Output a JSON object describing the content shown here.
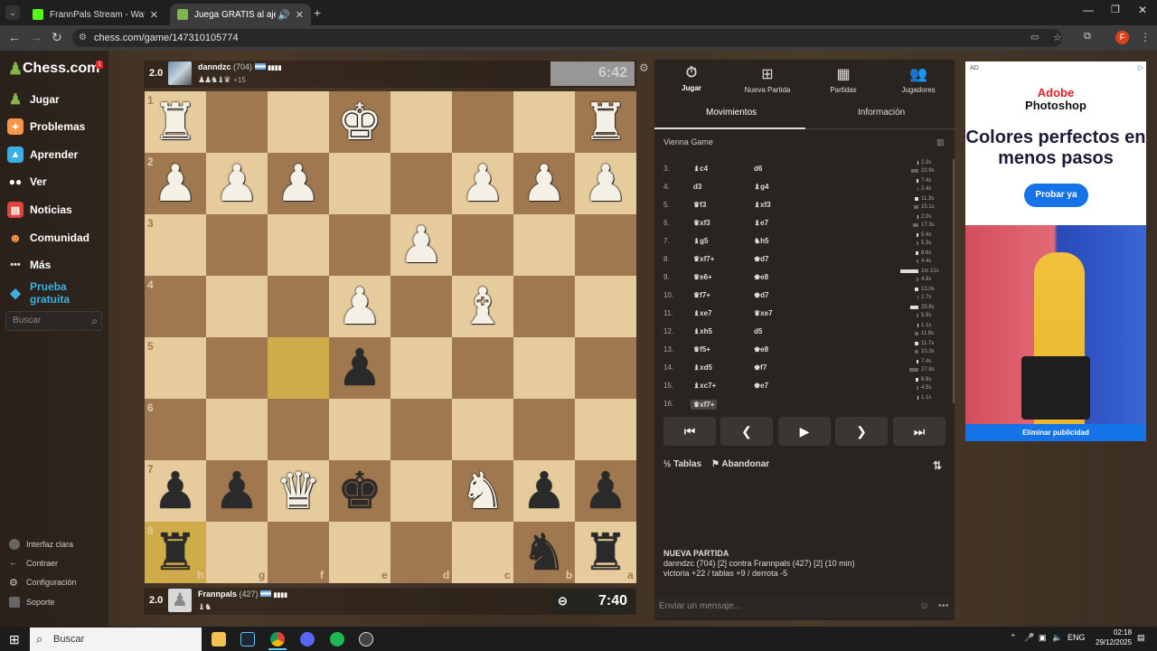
{
  "browser": {
    "tabs": [
      {
        "title": "FrannPals Stream - Watch Live o",
        "icon_color": "#53fc18",
        "active": false
      },
      {
        "title": "Juega GRATIS al ajedrez onl",
        "icon_color": "#81b64c",
        "active": true
      }
    ],
    "url": "chess.com/game/147310105774",
    "profile_initial": "F",
    "profile_color": "#d9421d"
  },
  "sidebar": {
    "logo": "Chess.com",
    "notification_count": "1",
    "items": [
      {
        "label": "Jugar",
        "icon": "pawn-icon",
        "color": "#81b64c"
      },
      {
        "label": "Problemas",
        "icon": "puzzle-icon",
        "color": "#f7954a"
      },
      {
        "label": "Aprender",
        "icon": "learn-icon",
        "color": "#3bb0e5"
      },
      {
        "label": "Ver",
        "icon": "binoculars-icon",
        "color": "#ffffff"
      },
      {
        "label": "Noticias",
        "icon": "news-icon",
        "color": "#e0443a"
      },
      {
        "label": "Comunidad",
        "icon": "community-icon",
        "color": "#f7954a"
      },
      {
        "label": "Más",
        "icon": "more-icon",
        "color": "#ffffff"
      },
      {
        "label": "Prueba gratuita",
        "icon": "diamond-icon",
        "color": "#3bb0e5"
      }
    ],
    "search_placeholder": "Buscar",
    "bottom": [
      "Interfaz clara",
      "Contraer",
      "Configuración",
      "Soporte"
    ]
  },
  "top_player": {
    "elo_diff": "2.0",
    "name": "danndzc",
    "rating": "(704)",
    "captured": "♟♟♞♝♛",
    "advantage": "+15",
    "clock": "6:42"
  },
  "bottom_player": {
    "elo_diff": "2.0",
    "name": "Frannpals",
    "rating": "(427)",
    "captured": "♝♞",
    "clock": "7:40"
  },
  "board": {
    "orientation": "black",
    "rank_labels": [
      "1",
      "2",
      "3",
      "4",
      "5",
      "6",
      "7",
      "8"
    ],
    "file_labels": [
      "h",
      "g",
      "f",
      "e",
      "d",
      "c",
      "b",
      "a"
    ],
    "rows": [
      [
        "wR",
        "",
        "",
        "wK",
        "",
        "",
        "",
        "wR"
      ],
      [
        "wP",
        "wP",
        "wP",
        "",
        "",
        "wP",
        "wP",
        "wP"
      ],
      [
        "",
        "",
        "",
        "",
        "wP",
        "",
        "",
        ""
      ],
      [
        "",
        "",
        "",
        "wP",
        "",
        "wB",
        "",
        ""
      ],
      [
        "",
        "",
        "",
        "bP",
        "",
        "",
        "",
        ""
      ],
      [
        "",
        "",
        "",
        "",
        "",
        "",
        "",
        ""
      ],
      [
        "bP",
        "bP",
        "wQ",
        "bK",
        "",
        "wN",
        "bP",
        "bP"
      ],
      [
        "bR",
        "",
        "",
        "",
        "",
        "",
        "bN",
        "bR"
      ]
    ],
    "highlights": [
      "f5",
      "h8"
    ]
  },
  "panel": {
    "tabs": [
      "Jugar",
      "Nueva Partida",
      "Partidas",
      "Jugadores"
    ],
    "subtabs": [
      "Movimientos",
      "Información"
    ],
    "opening": "Vienna Game",
    "moves": [
      {
        "num": "3.",
        "white": "♝c4",
        "black": "d6",
        "wt": "2.3s",
        "bt": "22.9s",
        "wf": 0.05,
        "bf": 0.4
      },
      {
        "num": "4.",
        "white": "d3",
        "black": "♝g4",
        "wt": "7.4s",
        "bt": "2.4s",
        "wf": 0.12,
        "bf": 0.05
      },
      {
        "num": "5.",
        "white": "♛f3",
        "black": "♝xf3",
        "wt": "11.3s",
        "bt": "15.1s",
        "wf": 0.2,
        "bf": 0.27
      },
      {
        "num": "6.",
        "white": "♛xf3",
        "black": "♝e7",
        "wt": "2.0s",
        "bt": "17.3s",
        "wf": 0.05,
        "bf": 0.3
      },
      {
        "num": "7.",
        "white": "♝g5",
        "black": "♞h5",
        "wt": "5.4s",
        "bt": "5.3s",
        "wf": 0.1,
        "bf": 0.1
      },
      {
        "num": "8.",
        "white": "♛xf7+",
        "black": "♚d7",
        "wt": "8.6s",
        "bt": "4.4s",
        "wf": 0.15,
        "bf": 0.08
      },
      {
        "num": "9.",
        "white": "♛e6+",
        "black": "♚e8",
        "wt": "1m 21s",
        "bt": "4.9s",
        "wf": 1.0,
        "bf": 0.09
      },
      {
        "num": "10.",
        "white": "♛f7+",
        "black": "♚d7",
        "wt": "13.0s",
        "bt": "2.7s",
        "wf": 0.22,
        "bf": 0.05
      },
      {
        "num": "11.",
        "white": "♝xe7",
        "black": "♛xe7",
        "wt": "25.8s",
        "bt": "5.9s",
        "wf": 0.45,
        "bf": 0.1
      },
      {
        "num": "12.",
        "white": "♝xh5",
        "black": "d5",
        "wt": "1.1s",
        "bt": "11.8s",
        "wf": 0.03,
        "bf": 0.2
      },
      {
        "num": "13.",
        "white": "♛f5+",
        "black": "♚e8",
        "wt": "11.7s",
        "bt": "10.3s",
        "wf": 0.2,
        "bf": 0.18
      },
      {
        "num": "14.",
        "white": "♝xd5",
        "black": "♚f7",
        "wt": "7.4s",
        "bt": "27.8s",
        "wf": 0.12,
        "bf": 0.48
      },
      {
        "num": "15.",
        "white": "♝xc7+",
        "black": "♚e7",
        "wt": "8.8s",
        "bt": "4.5s",
        "wf": 0.15,
        "bf": 0.08
      },
      {
        "num": "16.",
        "white": "♛xf7+",
        "black": "",
        "wt": "1.1s",
        "bt": "",
        "wf": 0.03,
        "bf": 0
      }
    ],
    "actions": [
      "Tablas",
      "Abandonar"
    ],
    "new_game": {
      "title": "NUEVA PARTIDA",
      "line1": "danndzc (704) [2] contra Frannpals (427) [2] (10 min)",
      "line2": "victoria +22 / tablas +9 / derrota -5"
    },
    "message_placeholder": "Enviar un mensaje..."
  },
  "ad": {
    "label": "AD",
    "brand": "Adobe",
    "product": "Photoshop",
    "headline": "Colores perfectos en menos pasos",
    "cta": "Probar ya",
    "remove": "Eliminar publicidad"
  },
  "taskbar": {
    "search": "Buscar",
    "lang": "ENG",
    "time": "02:18",
    "date": "29/12/2025"
  }
}
